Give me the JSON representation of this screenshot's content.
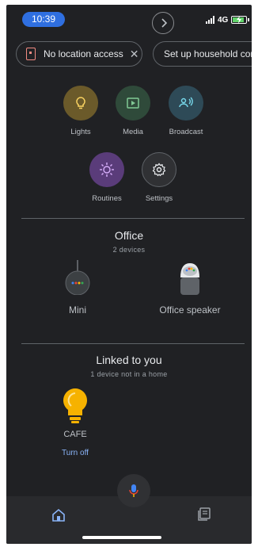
{
  "status_bar": {
    "time": "10:39",
    "network": "4G"
  },
  "chips": {
    "location": "No location access",
    "household": "Set up household contacts"
  },
  "actions": [
    {
      "label": "Lights",
      "icon": "lightbulb-icon",
      "color": "#6b5a2a"
    },
    {
      "label": "Media",
      "icon": "play-icon",
      "color": "#2f4a3a"
    },
    {
      "label": "Broadcast",
      "icon": "broadcast-icon",
      "color": "#2e4a57"
    },
    {
      "label": "Routines",
      "icon": "routines-icon",
      "color": "#5a3c7a"
    },
    {
      "label": "Settings",
      "icon": "gear-icon",
      "color": "#303134"
    }
  ],
  "office": {
    "title": "Office",
    "subtitle": "2 devices",
    "devices": [
      {
        "label": "Mini",
        "icon": "nest-mini-icon"
      },
      {
        "label": "Office speaker",
        "icon": "google-home-icon"
      }
    ]
  },
  "linked": {
    "title": "Linked to you",
    "subtitle": "1 device not in a home",
    "device": {
      "label": "CAFE",
      "icon": "bulb-on-icon",
      "action": "Turn off"
    }
  },
  "colors": {
    "accent": "#8ab4f8",
    "background": "#202124",
    "bulb": "#f6b200"
  }
}
